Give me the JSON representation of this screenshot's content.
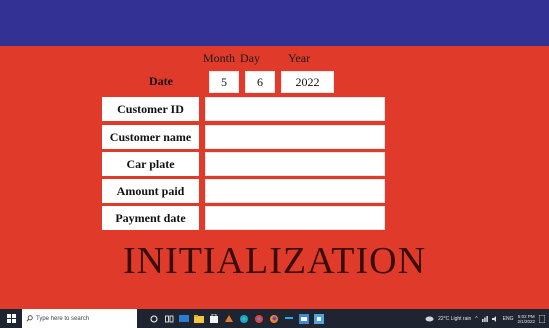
{
  "header": {
    "month_label": "Month",
    "day_label": "Day",
    "year_label": "Year"
  },
  "date": {
    "label": "Date",
    "month": "5",
    "day": "6",
    "year": "2022"
  },
  "form": {
    "rows": [
      {
        "label": "Customer ID",
        "value": ""
      },
      {
        "label": "Customer name",
        "value": ""
      },
      {
        "label": "Car plate",
        "value": ""
      },
      {
        "label": "Amount paid",
        "value": ""
      },
      {
        "label": "Payment date",
        "value": ""
      }
    ]
  },
  "title": "INITIALIZATION",
  "taskbar": {
    "search_placeholder": "Type here to search",
    "weather": "22°C Light rain",
    "lang": "ENG",
    "time": "5:02 PM",
    "date": "2/1/2022"
  },
  "colors": {
    "background": "#e03a2a",
    "topbar": "#333194",
    "title_text": "#3a0c08"
  }
}
